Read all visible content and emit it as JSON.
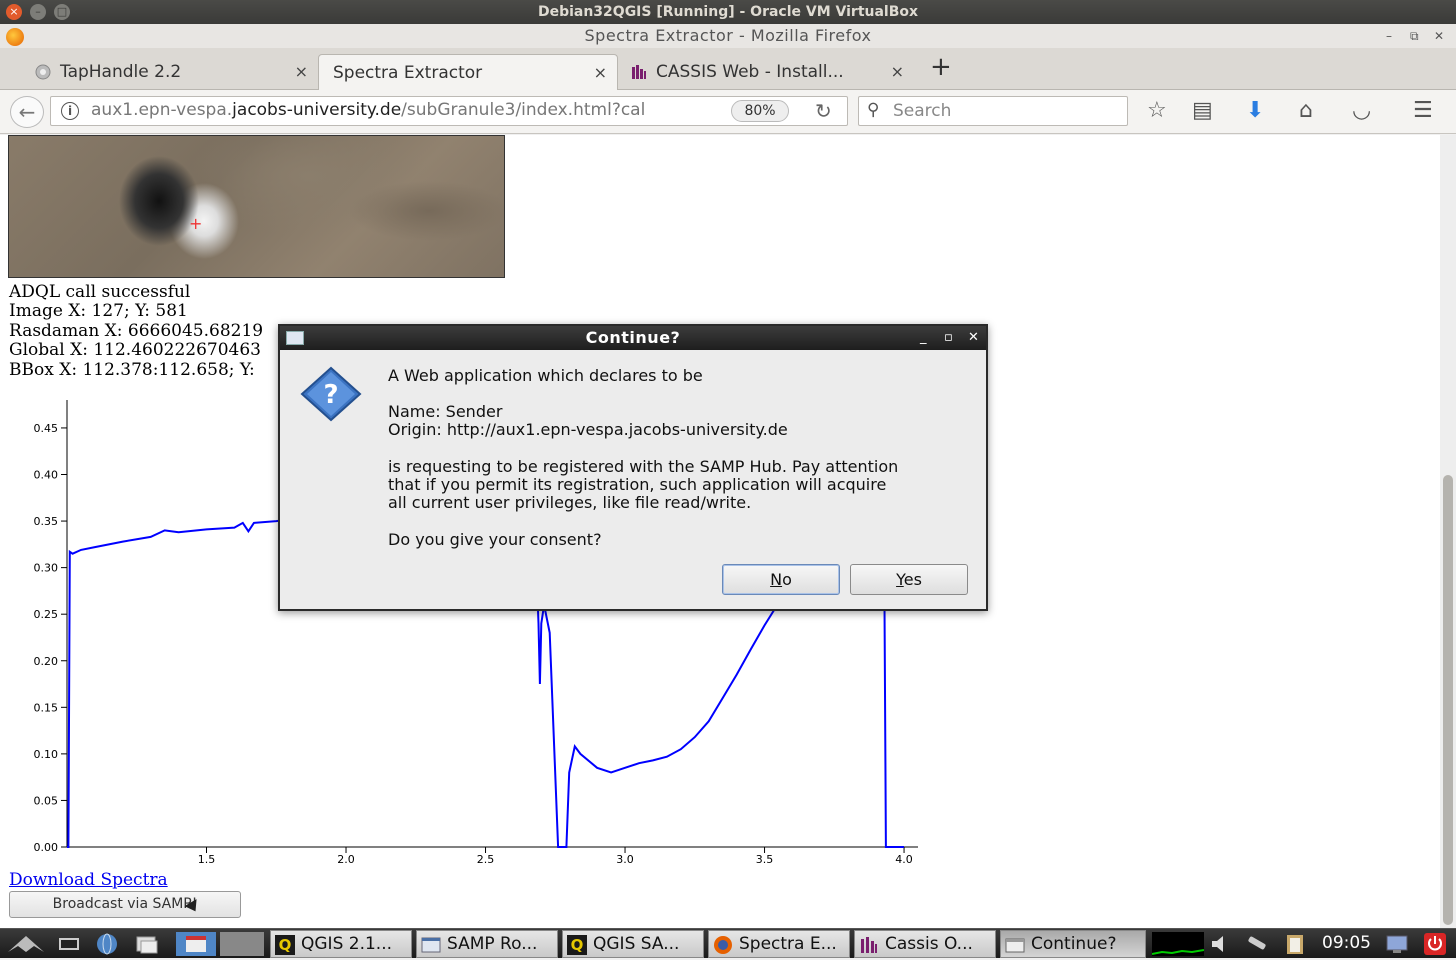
{
  "vbox": {
    "title": "Debian32QGIS [Running] - Oracle VM VirtualBox"
  },
  "firefox": {
    "window_title": "Spectra Extractor - Mozilla Firefox",
    "tabs": [
      {
        "label": "TapHandle 2.2",
        "close": "×"
      },
      {
        "label": "Spectra Extractor",
        "close": "×"
      },
      {
        "label": "CASSIS Web - Install...",
        "close": "×"
      }
    ],
    "new_tab": "+",
    "url_prefix": "aux1.epn-vespa.",
    "url_host": "jacobs-university.de",
    "url_path": "/subGranule3/index.html?cal",
    "zoom": "80%",
    "search_placeholder": "Search"
  },
  "page": {
    "adql_status": "ADQL call successful",
    "image_xy": "Image X: 127; Y: 581",
    "rasdaman_xy": "Rasdaman X: 6666045.68219",
    "global_xy": "Global X: 112.460222670463",
    "bbox": "BBox X: 112.378:112.658; Y:",
    "download_label": "Download Spectra",
    "broadcast_label": "Broadcast via SAMP!"
  },
  "chart_data": {
    "type": "line",
    "title": "",
    "xlabel": "",
    "ylabel": "",
    "xlim": [
      1.0,
      4.05
    ],
    "ylim": [
      0.0,
      0.48
    ],
    "x_ticks": [
      "1.5",
      "2.0",
      "2.5",
      "3.0",
      "3.5",
      "4.0"
    ],
    "y_ticks": [
      "0.00",
      "0.05",
      "0.10",
      "0.15",
      "0.20",
      "0.25",
      "0.30",
      "0.35",
      "0.40",
      "0.45"
    ],
    "color": "#0000ff",
    "series": [
      {
        "points": [
          [
            1.0,
            0.0
          ],
          [
            1.005,
            0.0
          ],
          [
            1.01,
            0.317
          ],
          [
            1.02,
            0.315
          ],
          [
            1.05,
            0.319
          ],
          [
            1.1,
            0.322
          ],
          [
            1.2,
            0.328
          ],
          [
            1.3,
            0.333
          ],
          [
            1.35,
            0.34
          ],
          [
            1.4,
            0.338
          ],
          [
            1.5,
            0.341
          ],
          [
            1.6,
            0.343
          ],
          [
            1.63,
            0.348
          ],
          [
            1.65,
            0.339
          ],
          [
            1.67,
            0.348
          ],
          [
            1.75,
            0.35
          ],
          [
            1.8,
            0.352
          ],
          [
            2.68,
            0.32
          ],
          [
            2.69,
            0.24
          ],
          [
            2.695,
            0.175
          ],
          [
            2.7,
            0.24
          ],
          [
            2.71,
            0.26
          ],
          [
            2.73,
            0.23
          ],
          [
            2.76,
            0.0
          ],
          [
            2.79,
            0.0
          ],
          [
            2.8,
            0.08
          ],
          [
            2.82,
            0.108
          ],
          [
            2.84,
            0.1
          ],
          [
            2.9,
            0.085
          ],
          [
            2.95,
            0.08
          ],
          [
            3.0,
            0.085
          ],
          [
            3.05,
            0.09
          ],
          [
            3.1,
            0.093
          ],
          [
            3.15,
            0.097
          ],
          [
            3.2,
            0.105
          ],
          [
            3.25,
            0.118
          ],
          [
            3.3,
            0.135
          ],
          [
            3.35,
            0.16
          ],
          [
            3.4,
            0.185
          ],
          [
            3.45,
            0.212
          ],
          [
            3.5,
            0.238
          ],
          [
            3.55,
            0.262
          ],
          [
            3.6,
            0.285
          ],
          [
            3.93,
            0.26
          ],
          [
            3.935,
            0.0
          ],
          [
            4.0,
            0.0
          ]
        ]
      }
    ]
  },
  "dialog": {
    "title": "Continue?",
    "line1": "A Web application which declares to be",
    "name": "Name: Sender",
    "origin": "Origin: http://aux1.epn-vespa.jacobs-university.de",
    "warn1": "is requesting to be registered with the SAMP Hub.  Pay attention",
    "warn2": "that if you permit its registration, such application will acquire",
    "warn3": "all current user privileges, like file read/write.",
    "question": "Do you give your consent?",
    "no_rest": "o",
    "no_mnemonic": "N",
    "yes_mnemonic": "Y",
    "yes_rest": "es"
  },
  "taskbar": {
    "tasks": [
      {
        "label": "QGIS 2.1..."
      },
      {
        "label": "SAMP Ro..."
      },
      {
        "label": "QGIS SA..."
      },
      {
        "label": "Spectra E..."
      },
      {
        "label": "Cassis O..."
      },
      {
        "label": "Continue?"
      }
    ],
    "clock": "09:05"
  }
}
